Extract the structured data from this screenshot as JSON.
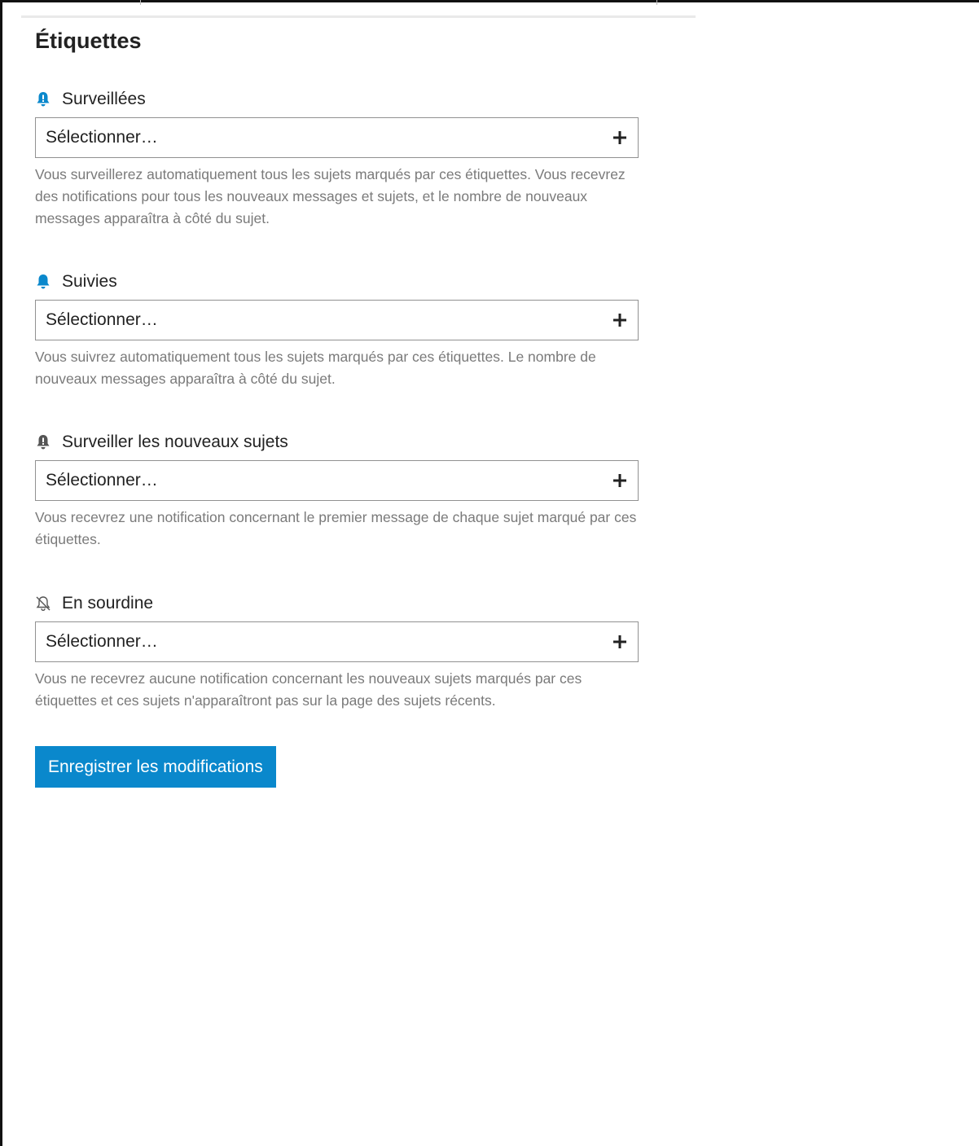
{
  "page": {
    "title": "Étiquettes"
  },
  "sections": [
    {
      "label": "Surveillées",
      "icon": "bell-exclamation-icon",
      "icon_color": "#0a88cc",
      "placeholder": "Sélectionner…",
      "description": "Vous surveillerez automatiquement tous les sujets marqués par ces étiquettes. Vous recevrez des notifications pour tous les nouveaux messages et sujets, et le nombre de nouveaux messages apparaîtra à côté du sujet."
    },
    {
      "label": "Suivies",
      "icon": "bell-icon",
      "icon_color": "#0a88cc",
      "placeholder": "Sélectionner…",
      "description": "Vous suivrez automatiquement tous les sujets marqués par ces étiquettes. Le nombre de nouveaux messages apparaîtra à côté du sujet."
    },
    {
      "label": "Surveiller les nouveaux sujets",
      "icon": "bell-exclamation-icon",
      "icon_color": "#555555",
      "placeholder": "Sélectionner…",
      "description": "Vous recevrez une notification concernant le premier message de chaque sujet marqué par ces étiquettes."
    },
    {
      "label": "En sourdine",
      "icon": "bell-slash-icon",
      "icon_color": "#555555",
      "placeholder": "Sélectionner…",
      "description": "Vous ne recevrez aucune notification concernant les nouveaux sujets marqués par ces étiquettes et ces sujets n'apparaîtront pas sur la page des sujets récents."
    }
  ],
  "actions": {
    "save_label": "Enregistrer les modifications",
    "save_color": "#0a88cc"
  }
}
